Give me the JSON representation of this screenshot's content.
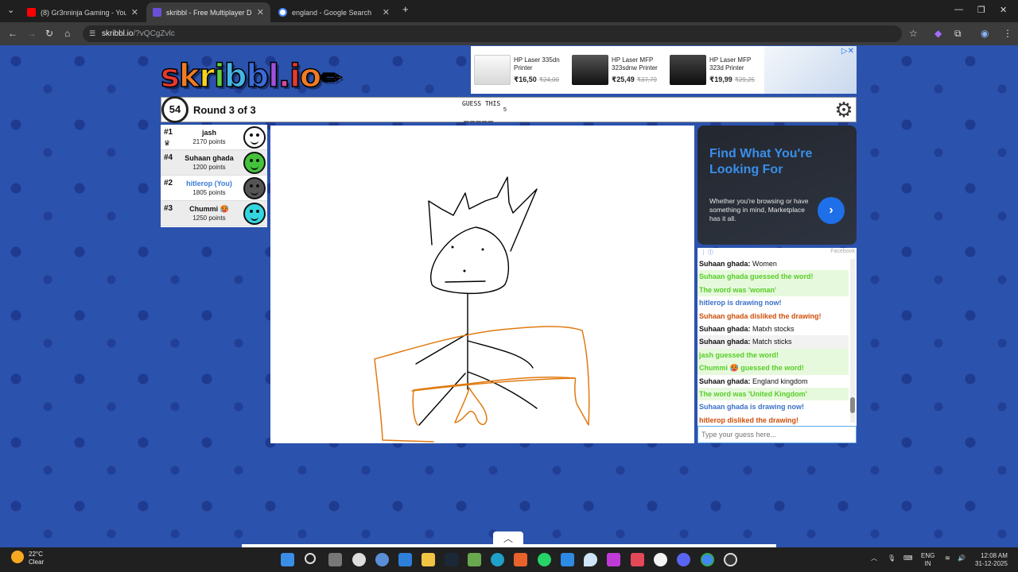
{
  "browser": {
    "tabs": [
      {
        "title": "(8) Gr3nninja Gaming - YouTube",
        "color": "#ff0000"
      },
      {
        "title": "skribbl - Free Multiplayer Draw",
        "color": "#6b4fd6"
      },
      {
        "title": "england - Google Search",
        "color": "#4285f4"
      }
    ],
    "new_tab": "+",
    "url_host": "skribbl.io",
    "url_path": "/?vQCgZvlc"
  },
  "logo": {
    "text": "skribbl.io",
    "pencil": "✏"
  },
  "top_ad": {
    "items": [
      {
        "title": "HP Laser 335dn Printer",
        "price": "₹16,50",
        "old": "₹24,00"
      },
      {
        "title": "HP Laser MFP 323sdnw Printer",
        "price": "₹25,49",
        "old": "₹37,79"
      },
      {
        "title": "HP Laser MFP 323d Printer",
        "price": "₹19,99",
        "old": "₹29,25"
      }
    ]
  },
  "game": {
    "timer": "54",
    "round": "Round 3 of 3",
    "guess_label": "GUESS THIS",
    "guess_count": "5",
    "word_blanks": "_____"
  },
  "players": [
    {
      "rank": "#1",
      "name": "jash",
      "points": "2170 points",
      "color": "#ffffff",
      "crown": "♛"
    },
    {
      "rank": "#4",
      "name": "Suhaan ghada",
      "points": "1200 points",
      "color": "#44c43a",
      "crown": ""
    },
    {
      "rank": "#2",
      "name": "hitlerop (You)",
      "points": "1805 points",
      "color": "#555555",
      "crown": ""
    },
    {
      "rank": "#3",
      "name": "Chummi 🥵",
      "points": "1250 points",
      "color": "#33d6e0",
      "crown": ""
    }
  ],
  "side_ad": {
    "headline": "Find What You're Looking For",
    "body": "Whether you're browsing or have something in mind, Marketplace has it all.",
    "go": "›",
    "source": "Facebook"
  },
  "chat": [
    {
      "who": "Suhaan ghada:",
      "text": " Women",
      "style": ""
    },
    {
      "who": "",
      "text": "Suhaan ghada guessed the word!",
      "style": "green"
    },
    {
      "who": "",
      "text": "The word was 'woman'",
      "style": "green"
    },
    {
      "who": "",
      "text": "hitlerop is drawing now!",
      "style": "blue"
    },
    {
      "who": "",
      "text": "Suhaan ghada disliked the drawing!",
      "style": "orange"
    },
    {
      "who": "Suhaan ghada:",
      "text": " Matxh stocks",
      "style": ""
    },
    {
      "who": "Suhaan ghada:",
      "text": " Match sticks",
      "style": "alt"
    },
    {
      "who": "",
      "text": "jash guessed the word!",
      "style": "green"
    },
    {
      "who": "",
      "text": "Chummi 🥵 guessed the word!",
      "style": "green"
    },
    {
      "who": "Suhaan ghada:",
      "text": " England kingdom",
      "style": ""
    },
    {
      "who": "",
      "text": "The word was 'United Kingdom'",
      "style": "green"
    },
    {
      "who": "",
      "text": "Suhaan ghada is drawing now!",
      "style": "blue"
    },
    {
      "who": "",
      "text": "hitlerop disliked the drawing!",
      "style": "orange"
    }
  ],
  "chat_input": {
    "placeholder": "Type your guess here..."
  },
  "taskbar": {
    "temp": "22°C",
    "condition": "Clear",
    "lang1": "ENG",
    "lang2": "IN",
    "time": "12:08 AM",
    "date": "31-12-2025"
  }
}
